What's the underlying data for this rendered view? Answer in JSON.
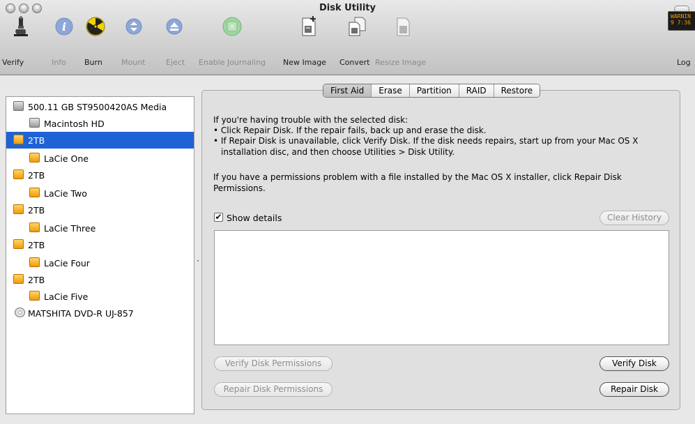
{
  "window": {
    "title": "Disk Utility"
  },
  "toolbar": {
    "items": [
      {
        "label": "Verify",
        "icon": "microscope-icon"
      },
      {
        "label": "Info",
        "icon": "info-icon"
      },
      {
        "label": "Burn",
        "icon": "burn-icon"
      },
      {
        "label": "Mount",
        "icon": "mount-icon"
      },
      {
        "label": "Eject",
        "icon": "eject-icon"
      },
      {
        "label": "Enable Journaling",
        "icon": "journaling-icon"
      },
      {
        "label": "New Image",
        "icon": "new-image-icon"
      },
      {
        "label": "Convert",
        "icon": "convert-icon"
      },
      {
        "label": "Resize Image",
        "icon": "resize-image-icon"
      }
    ],
    "log_label": "Log",
    "log_badge": "WARNIN",
    "log_time": "9 7:36"
  },
  "sidebar": {
    "devices": [
      {
        "label": "500.11 GB ST9500420AS Media",
        "icon": "hard-disk-icon",
        "indent": 0,
        "selected": false
      },
      {
        "label": "Macintosh HD",
        "icon": "volume-icon",
        "indent": 1,
        "selected": false
      },
      {
        "label": "2TB",
        "icon": "external-disk-icon",
        "indent": 0,
        "selected": true
      },
      {
        "label": "LaCie One",
        "icon": "external-volume-icon",
        "indent": 1,
        "selected": false
      },
      {
        "label": "2TB",
        "icon": "external-disk-icon",
        "indent": 0,
        "selected": false
      },
      {
        "label": "LaCie Two",
        "icon": "external-volume-icon",
        "indent": 1,
        "selected": false
      },
      {
        "label": "2TB",
        "icon": "external-disk-icon",
        "indent": 0,
        "selected": false
      },
      {
        "label": "LaCie Three",
        "icon": "external-volume-icon",
        "indent": 1,
        "selected": false
      },
      {
        "label": "2TB",
        "icon": "external-disk-icon",
        "indent": 0,
        "selected": false
      },
      {
        "label": "LaCie Four",
        "icon": "external-volume-icon",
        "indent": 1,
        "selected": false
      },
      {
        "label": "2TB",
        "icon": "external-disk-icon",
        "indent": 0,
        "selected": false
      },
      {
        "label": "LaCie Five",
        "icon": "external-volume-icon",
        "indent": 1,
        "selected": false
      },
      {
        "label": "MATSHITA DVD-R UJ-857",
        "icon": "dvd-drive-icon",
        "indent": 0,
        "selected": false
      }
    ]
  },
  "tabs": [
    {
      "label": "First Aid",
      "active": true
    },
    {
      "label": "Erase",
      "active": false
    },
    {
      "label": "Partition",
      "active": false
    },
    {
      "label": "RAID",
      "active": false
    },
    {
      "label": "Restore",
      "active": false
    }
  ],
  "first_aid": {
    "intro": "If you're having trouble with the selected disk:",
    "bullet1": "• Click Repair Disk. If the repair fails, back up and erase the disk.",
    "bullet2_line1": "• If Repair Disk is unavailable, click Verify Disk. If the disk needs repairs, start up from your Mac OS X",
    "bullet2_line2": "installation disc, and then choose Utilities > Disk Utility.",
    "permissions_line1": "If you have a permissions problem with a file installed by the Mac OS X installer, click Repair Disk",
    "permissions_line2": "Permissions.",
    "show_details_label": "Show details",
    "show_details_checked": true,
    "clear_history_label": "Clear History",
    "verify_permissions_label": "Verify Disk Permissions",
    "repair_permissions_label": "Repair Disk Permissions",
    "verify_disk_label": "Verify Disk",
    "repair_disk_label": "Repair Disk"
  }
}
